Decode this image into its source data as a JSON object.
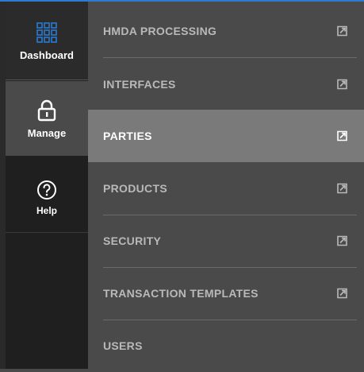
{
  "colors": {
    "accent": "#2a7bd1",
    "active_bg": "#7a7a7a",
    "menu_bg": "#4a4a4a",
    "rail_bg": "#1f1f1f"
  },
  "rail": {
    "items": [
      {
        "label": "Dashboard",
        "icon": "grid-icon"
      },
      {
        "label": "Manage",
        "icon": "lock-icon"
      },
      {
        "label": "Help",
        "icon": "help-icon"
      }
    ]
  },
  "menu": {
    "items": [
      {
        "label": "HMDA PROCESSING",
        "icon": "external-link-icon"
      },
      {
        "label": "INTERFACES",
        "icon": "external-link-icon"
      },
      {
        "label": "PARTIES",
        "icon": "external-link-icon",
        "active": true
      },
      {
        "label": "PRODUCTS",
        "icon": "external-link-icon"
      },
      {
        "label": "SECURITY",
        "icon": "external-link-icon"
      },
      {
        "label": "TRANSACTION TEMPLATES",
        "icon": "external-link-icon"
      },
      {
        "label": "USERS"
      }
    ]
  }
}
